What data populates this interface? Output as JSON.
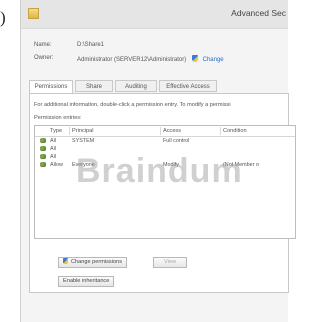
{
  "margin_mark": ")",
  "window": {
    "title": "Advanced Sec"
  },
  "properties": {
    "name_label": "Name:",
    "name_value": "D:\\Share1",
    "owner_label": "Owner:",
    "owner_value": "Administrator (SERVER12\\Administrator)",
    "change_link": "Change"
  },
  "tabs": [
    {
      "label": "Permissions",
      "active": true
    },
    {
      "label": "Share",
      "active": false
    },
    {
      "label": "Auditing",
      "active": false
    },
    {
      "label": "Effective Access",
      "active": false
    }
  ],
  "panel": {
    "info_text": "For additional information, double-click a permission entry. To modify a permissi",
    "entries_label": "Permission entries:"
  },
  "grid": {
    "columns": [
      "Type",
      "Principal",
      "Access",
      "Condition"
    ],
    "rows": [
      {
        "type": "All",
        "principal": "SYSTEM",
        "access": "Full control",
        "condition": ""
      },
      {
        "type": "All",
        "principal": "",
        "access": "",
        "condition": ""
      },
      {
        "type": "All",
        "principal": "",
        "access": "",
        "condition": ""
      },
      {
        "type": "Allow",
        "principal": "Everyone",
        "access": "Modify",
        "condition": "(Not Member o"
      }
    ]
  },
  "watermark": "Braindum",
  "buttons": {
    "change_permissions": "Change permissions",
    "view": "View",
    "enable_inheritance": "Enable inheritance"
  },
  "colors": {
    "link": "#2a6ac8",
    "titlebar": "#e5e5e5",
    "window_bg": "#f4f4f4"
  }
}
